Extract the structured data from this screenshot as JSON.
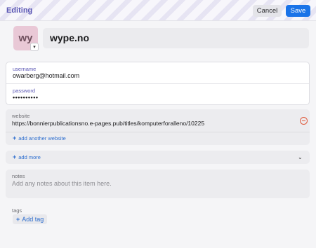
{
  "header": {
    "title": "Editing",
    "cancel_label": "Cancel",
    "save_label": "Save"
  },
  "item": {
    "avatar_initials": "wy",
    "title": "wype.no"
  },
  "credentials": {
    "username_label": "username",
    "username_value": "owarberg@hotmail.com",
    "password_label": "password",
    "password_value": "••••••••••"
  },
  "website": {
    "label": "website",
    "value": "https://bonnierpublicationsno.e-pages.pub/titles/komputerforalleno/10225",
    "add_another_label": "add another website"
  },
  "add_more": {
    "label": "add more"
  },
  "notes": {
    "label": "notes",
    "placeholder": "Add any notes about this item here."
  },
  "tags": {
    "label": "tags",
    "add_tag_label": "Add tag"
  },
  "colors": {
    "accent": "#5a56b4",
    "primary_button": "#1a73e8",
    "link": "#2f6fcf",
    "remove": "#e05a3c",
    "avatar_bg": "#e9c8d6"
  },
  "icons": {
    "avatar_dropdown": "chevron-down-icon",
    "website_remove": "remove-circle-icon",
    "add": "plus-icon",
    "expand": "chevron-down-icon"
  }
}
